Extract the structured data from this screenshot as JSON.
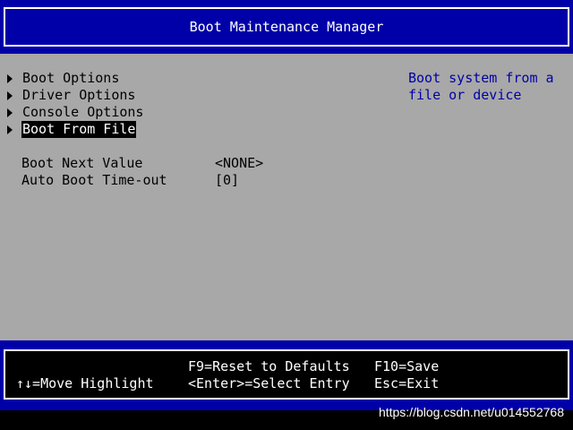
{
  "title": "Boot Maintenance Manager",
  "menu": {
    "items": [
      {
        "label": "Boot Options",
        "selected": false
      },
      {
        "label": "Driver Options",
        "selected": false
      },
      {
        "label": "Console Options",
        "selected": false
      },
      {
        "label": "Boot From File",
        "selected": true
      }
    ]
  },
  "options": {
    "boot_next": {
      "label": "Boot Next Value",
      "value": "<NONE>"
    },
    "auto_boot": {
      "label": "Auto Boot Time-out",
      "value": "[0]"
    }
  },
  "help": {
    "text": "Boot system from a\nfile or device"
  },
  "footer": {
    "move_highlight": "↑↓=Move Highlight",
    "reset_defaults": "F9=Reset to Defaults",
    "select_entry": "<Enter>=Select Entry",
    "save": "F10=Save",
    "exit": "Esc=Exit"
  },
  "watermark": "https://blog.csdn.net/u014552768",
  "colors": {
    "title_bg": "#0000a8",
    "main_bg": "#a8a8a8",
    "help_text": "#0000a8",
    "selected_bg": "#000000",
    "selected_fg": "#ffffff"
  }
}
